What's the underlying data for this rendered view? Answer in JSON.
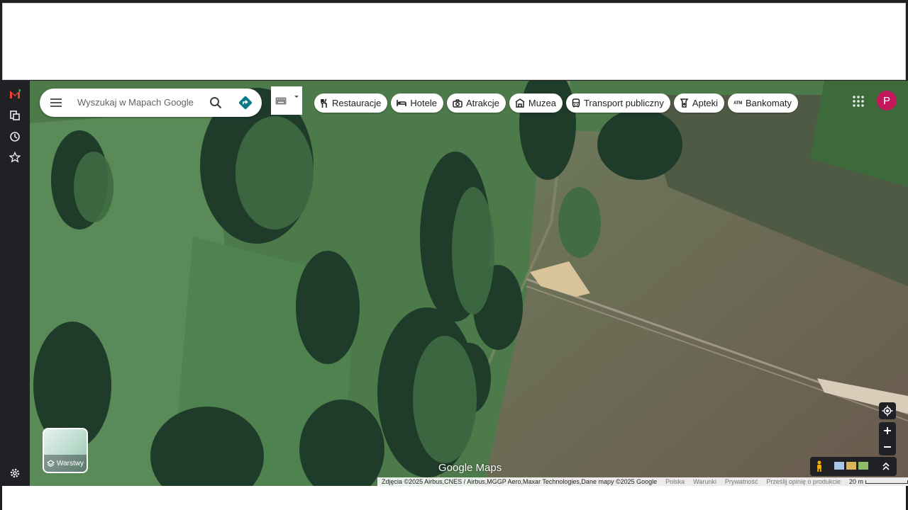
{
  "search": {
    "placeholder": "Wyszukaj w Mapach Google"
  },
  "chips": [
    {
      "icon": "fork-knife-icon",
      "label": "Restauracje"
    },
    {
      "icon": "bed-icon",
      "label": "Hotele"
    },
    {
      "icon": "camera-icon",
      "label": "Atrakcje"
    },
    {
      "icon": "museum-icon",
      "label": "Muzea"
    },
    {
      "icon": "bus-icon",
      "label": "Transport publiczny"
    },
    {
      "icon": "pharmacy-icon",
      "label": "Apteki"
    },
    {
      "icon": "atm-icon",
      "label": "Bankomaty",
      "icon_text": "ATM"
    }
  ],
  "account": {
    "initial": "P",
    "color": "#c2185b"
  },
  "layers": {
    "label": "Warstwy"
  },
  "branding": {
    "wordmark": "Google Maps"
  },
  "footer": {
    "attribution": "Zdjęcia ©2025 Airbus,CNES / Airbus,MGGP Aero,Maxar Technologies,Dane mapy ©2025 Google",
    "country": "Polska",
    "terms": "Warunki",
    "privacy": "Prywatność",
    "feedback": "Prześlij opinię o produkcie",
    "scale": "20 m"
  },
  "colors": {
    "rail_bg": "#202124",
    "accent": "#1a73e8",
    "directions": "#0b7a86"
  }
}
